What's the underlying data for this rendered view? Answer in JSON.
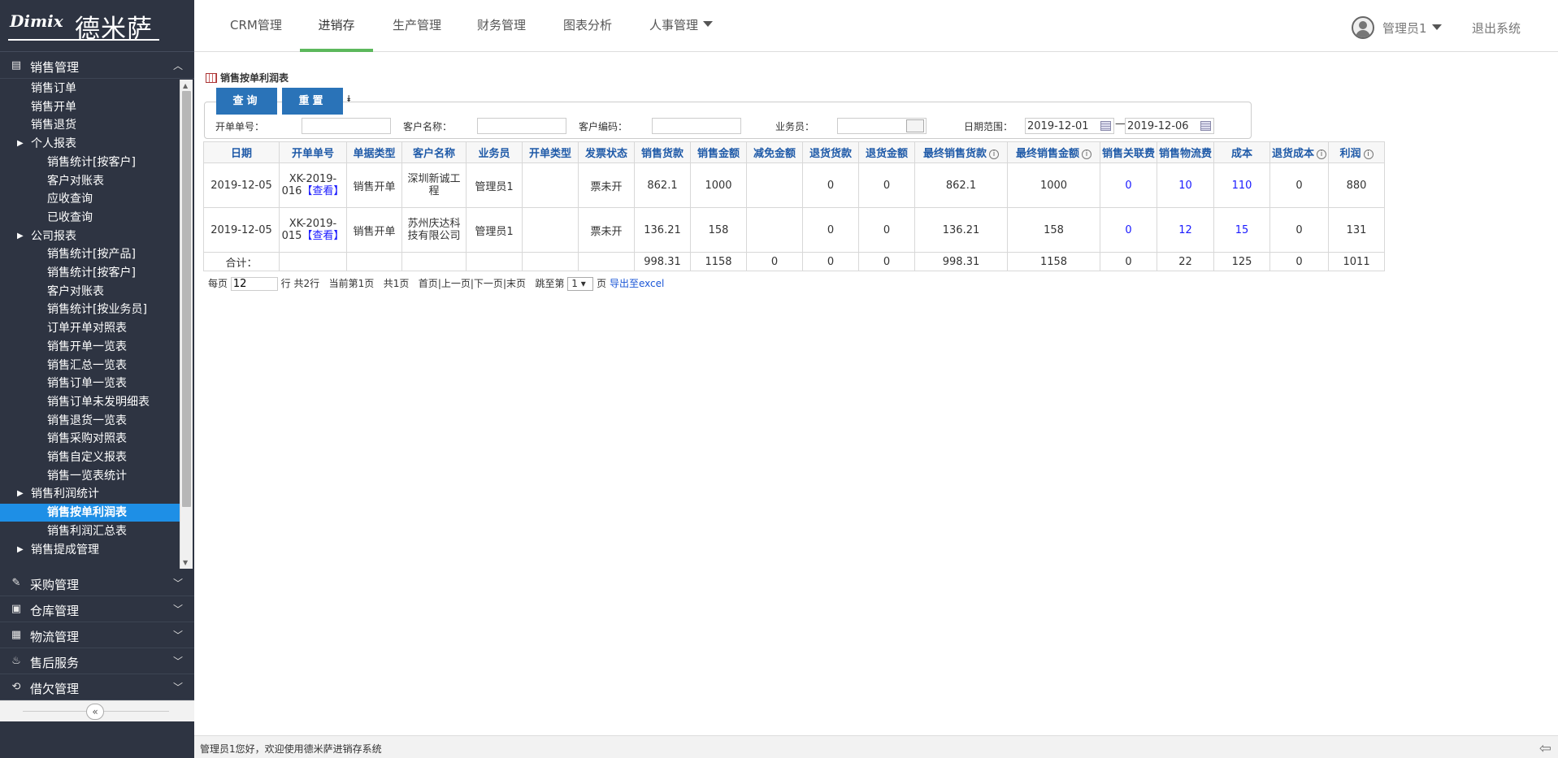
{
  "brand": {
    "latin": "Dimix",
    "cn": "德米萨"
  },
  "nav": {
    "items": [
      "CRM管理",
      "进销存",
      "生产管理",
      "财务管理",
      "图表分析",
      "人事管理"
    ],
    "user": "管理员1",
    "logout": "退出系统"
  },
  "sidebar": {
    "sales_section": "销售管理",
    "tree": [
      {
        "label": "销售订单",
        "level": 1
      },
      {
        "label": "销售开单",
        "level": 1
      },
      {
        "label": "销售退货",
        "level": 1
      },
      {
        "label": "个人报表",
        "level": 1,
        "group": true
      },
      {
        "label": "销售统计[按客户]",
        "level": 2
      },
      {
        "label": "客户对账表",
        "level": 2
      },
      {
        "label": "应收查询",
        "level": 2
      },
      {
        "label": "已收查询",
        "level": 2
      },
      {
        "label": "公司报表",
        "level": 1,
        "group": true
      },
      {
        "label": "销售统计[按产品]",
        "level": 2
      },
      {
        "label": "销售统计[按客户]",
        "level": 2
      },
      {
        "label": "客户对账表",
        "level": 2
      },
      {
        "label": "销售统计[按业务员]",
        "level": 2
      },
      {
        "label": "订单开单对照表",
        "level": 2
      },
      {
        "label": "销售开单一览表",
        "level": 2
      },
      {
        "label": "销售汇总一览表",
        "level": 2
      },
      {
        "label": "销售订单一览表",
        "level": 2
      },
      {
        "label": "销售订单未发明细表",
        "level": 2
      },
      {
        "label": "销售退货一览表",
        "level": 2
      },
      {
        "label": "销售采购对照表",
        "level": 2
      },
      {
        "label": "销售自定义报表",
        "level": 2
      },
      {
        "label": "销售一览表统计",
        "level": 2
      },
      {
        "label": "销售利润统计",
        "level": 1,
        "group": true
      },
      {
        "label": "销售按单利润表",
        "level": 2,
        "active": true
      },
      {
        "label": "销售利润汇总表",
        "level": 2
      },
      {
        "label": "销售提成管理",
        "level": 1,
        "group": true
      }
    ],
    "sections": [
      "采购管理",
      "仓库管理",
      "物流管理",
      "售后服务",
      "借欠管理"
    ]
  },
  "page": {
    "title": "销售按单利润表",
    "search": {
      "query_btn": "查询",
      "reset_btn": "重置",
      "order_label": "开单单号：",
      "customer_label": "客户名称：",
      "code_label": "客户编码：",
      "sales_label": "业务员：",
      "date_label": "日期范围：",
      "date_from": "2019-12-01",
      "date_to": "2019-12-06",
      "date_sep": "—"
    },
    "table": {
      "headers": [
        "日期",
        "开单单号",
        "单据类型",
        "客户名称",
        "业务员",
        "开单类型",
        "发票状态",
        "销售货款",
        "销售金额",
        "减免金额",
        "退货货款",
        "退货金额",
        "最终销售货款",
        "最终销售金额",
        "销售关联费",
        "销售物流费",
        "成本",
        "退货成本",
        "利润"
      ],
      "rows": [
        {
          "date": "2019-12-05",
          "order_no": "XK-2019-016",
          "view": "【查看】",
          "doc_type": "销售开单",
          "customer": "深圳新诚工程",
          "salesman": "管理员1",
          "open_type": "",
          "invoice": "票未开",
          "sale_goods": "862.1",
          "sale_amount": "1000",
          "discount": "",
          "ret_goods": "0",
          "ret_amount": "0",
          "final_goods": "862.1",
          "final_amount": "1000",
          "rel_fee": "0",
          "logistics_fee": "10",
          "cost": "110",
          "ret_cost": "0",
          "profit": "880"
        },
        {
          "date": "2019-12-05",
          "order_no": "XK-2019-015",
          "view": "【查看】",
          "doc_type": "销售开单",
          "customer": "苏州庆达科技有限公司",
          "salesman": "管理员1",
          "open_type": "",
          "invoice": "票未开",
          "sale_goods": "136.21",
          "sale_amount": "158",
          "discount": "",
          "ret_goods": "0",
          "ret_amount": "0",
          "final_goods": "136.21",
          "final_amount": "158",
          "rel_fee": "0",
          "logistics_fee": "12",
          "cost": "15",
          "ret_cost": "0",
          "profit": "131"
        }
      ],
      "total": {
        "label": "合计：",
        "sale_goods": "998.31",
        "sale_amount": "1158",
        "discount": "0",
        "ret_goods": "0",
        "ret_amount": "0",
        "final_goods": "998.31",
        "final_amount": "1158",
        "rel_fee": "0",
        "logistics_fee": "22",
        "cost": "125",
        "ret_cost": "0",
        "profit": "1011"
      }
    },
    "pager": {
      "per_page_label": "每页",
      "per_page": "12",
      "rows_unit": "行",
      "total": "共2行",
      "current": "当前第1页",
      "pages": "共1页",
      "first": "首页",
      "prev": "上一页",
      "next": "下一页",
      "last": "末页",
      "jump_label": "跳至第",
      "jump_value": "1 ▾",
      "page_unit": "页",
      "export": "导出至excel"
    }
  },
  "status": {
    "text": "管理员1您好，欢迎使用德米萨进销存系统"
  },
  "colors": {
    "sidebar": "#2e3442",
    "active": "#1e8fe6",
    "button": "#2a73b8",
    "nav_active": "#5cb85c",
    "header_text": "#1f5aa8",
    "link": "#1a1aff"
  }
}
